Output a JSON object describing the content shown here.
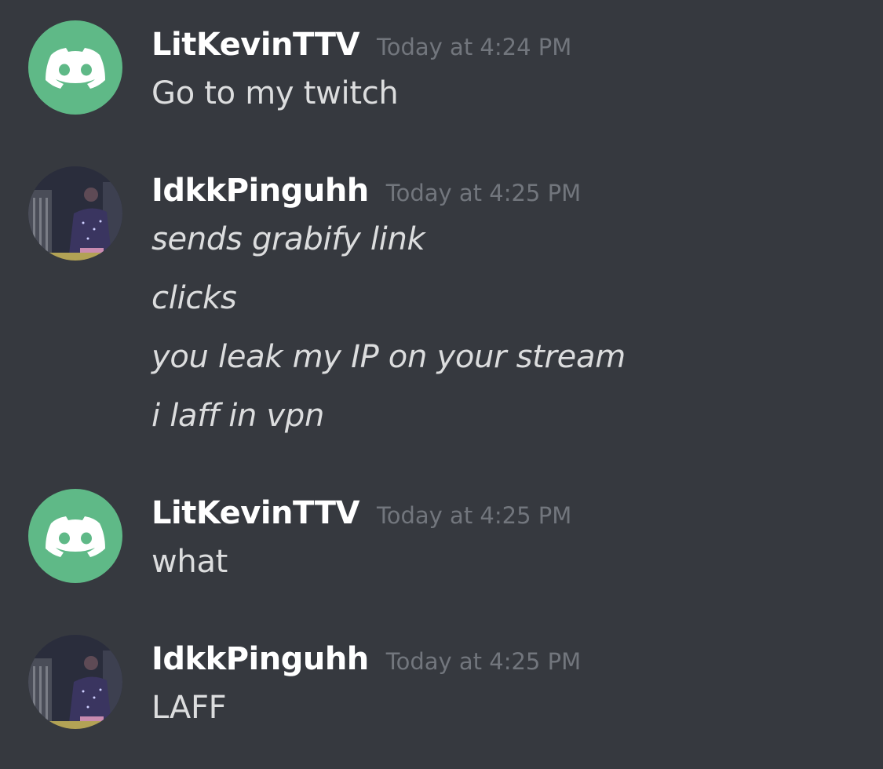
{
  "colors": {
    "background": "#36393f",
    "username": "#ffffff",
    "timestamp": "#72767d",
    "message_text": "#dcddde",
    "default_avatar": "#5fb987"
  },
  "messages": [
    {
      "username": "LitKevinTTV",
      "timestamp": "Today at 4:24 PM",
      "avatar": "discord-default-icon",
      "lines": [
        "Go to my twitch"
      ]
    },
    {
      "username": "IdkkPinguhh",
      "timestamp": "Today at 4:25 PM",
      "avatar": "user-photo",
      "lines": [
        "sends grabify link",
        "clicks",
        "you leak my IP on your stream",
        "i laff in vpn"
      ]
    },
    {
      "username": "LitKevinTTV",
      "timestamp": "Today at 4:25 PM",
      "avatar": "discord-default-icon",
      "lines": [
        "what"
      ]
    },
    {
      "username": "IdkkPinguhh",
      "timestamp": "Today at 4:25 PM",
      "avatar": "user-photo",
      "lines": [
        "LAFF"
      ]
    }
  ]
}
